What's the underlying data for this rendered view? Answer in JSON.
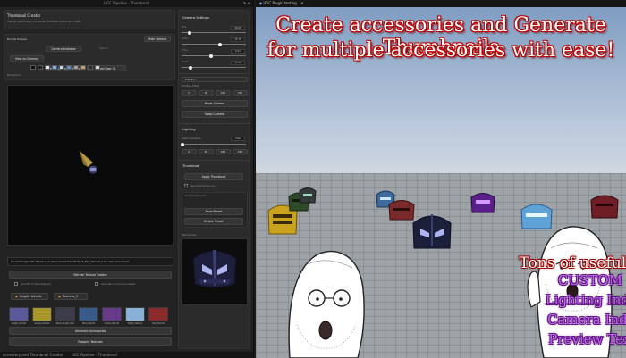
{
  "left_window": {
    "title": "UGC Pipeline - Thumbnail",
    "status_items": [
      "Accessory and Thumbnail Creator",
      "UGC Pipeline - Thumbnail"
    ]
  },
  "creator": {
    "title": "Thumbnail Creator",
    "description": "View all the accessory thumbnail thumbnail options and create",
    "hide_options_label": "Hide Options",
    "preview_section_label": "Normal Preview",
    "camera_indicator_label": "Camera Indicator",
    "view_on_dummy_label": "View on Dummy",
    "hide_lighting_label": "Hide Lighting Indicator",
    "load_user_id_label": "Load User ID",
    "user_id_label": "User ID",
    "background_label": "Background",
    "background_colors": [
      "#111111",
      "#1e1e1e",
      "#e8e8e8",
      "#7fb5e8",
      "#b9d3ea",
      "#5a8fc7",
      "#9e9e9e",
      "#c8a164",
      "#2a2a2a",
      "#d8d8d8"
    ],
    "status_message": "ServerStorage.UGC Pipeline.Accessories.Ball Helmet.Noob_Ball_Helmet_2 has been previewed.",
    "refresh_folders_label": "Refresh Texture Folders",
    "use_fov_label": "Use FOV to Reduce/Ignore",
    "generate_all_label": "Generate all previous viewed",
    "folder_a_label": "Knight Helmets",
    "folder_b_label": "Textures_3",
    "thumbnails": [
      {
        "label": "Knight_Helmet",
        "color": "#5a5a9a"
      },
      {
        "label": "Golden_Helmet",
        "color": "#a8962a"
      },
      {
        "label": "Black_Knight_Helmet",
        "color": "#3c3c4a"
      },
      {
        "label": "Blue_Helmet",
        "color": "#3a5a8a"
      },
      {
        "label": "Purple_Helmet",
        "color": "#6a3a8a"
      },
      {
        "label": "Bright_Helmet",
        "color": "#8ab0d8"
      },
      {
        "label": "Red_Helmet",
        "color": "#8a2a2a"
      }
    ],
    "generate_label": "Generate Accessories",
    "reapply_label": "Reapply Textures"
  },
  "settings": {
    "camera_title": "Camera Settings",
    "sliders": [
      {
        "label": "FOV",
        "value": "30.00",
        "fill": 0.1
      },
      {
        "label": "X Pos",
        "value": "15.72",
        "fill": 0.62
      },
      {
        "label": "Y Pos",
        "value": "6.21",
        "fill": 0.48
      },
      {
        "label": "Zoom",
        "value": "27.00",
        "fill": 0.12
      }
    ],
    "fov_label": "FOV: 6.1",
    "rotation_label": "Rotation Offset",
    "rotation_buttons": [
      "0",
      "90",
      "180",
      "270"
    ],
    "reset_camera_label": "Reset Camera",
    "swap_camera_label": "Swap Camera",
    "lighting_title": "Lighting",
    "lighting_rotation_label": "Lighting Rotation",
    "lighting_value": "0.00",
    "lighting_buttons": [
      "0",
      "90",
      "180",
      "270"
    ],
    "thumbnail_title": "Thumbnail",
    "apply_thumbnail_label": "Apply Thumbnail",
    "generate_spawn_label": "Generate Spawn only",
    "thumbnail_presets_label": "Thumbnail Presets",
    "save_preset_label": "Save Preset",
    "delete_preset_label": "Delete Preset",
    "preview_title": "PNG Preview"
  },
  "right_window": {
    "tab_label": "UGC Plugin testing",
    "headline_1": "Create accessories and Generate Thumbnails",
    "headline_2": "for multiple accessories with ease!",
    "features": [
      "Tons of useful features!",
      "CUSTOM FOV!",
      "Lighting Indicator!",
      "Camera Indicator!",
      "Preview Textures!"
    ],
    "feature_colors": [
      "#ffffff",
      "#c65ef5",
      "#c65ef5",
      "#c65ef5",
      "#c65ef5"
    ]
  }
}
